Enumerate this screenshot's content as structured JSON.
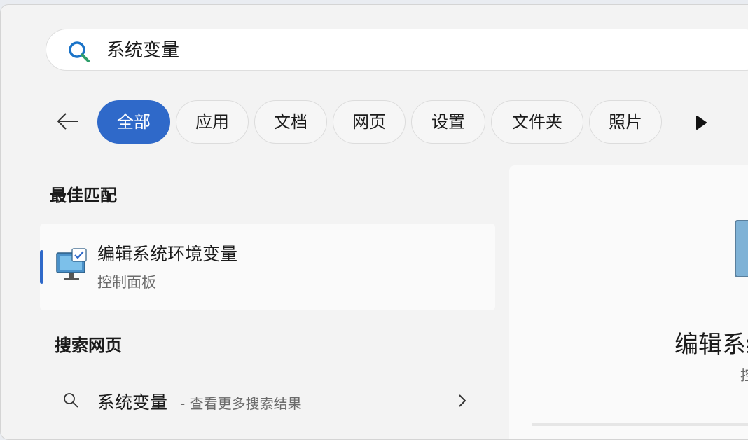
{
  "search": {
    "query": "系统变量"
  },
  "filters": [
    {
      "label": "全部",
      "active": true
    },
    {
      "label": "应用",
      "active": false
    },
    {
      "label": "文档",
      "active": false
    },
    {
      "label": "网页",
      "active": false
    },
    {
      "label": "设置",
      "active": false
    },
    {
      "label": "文件夹",
      "active": false
    },
    {
      "label": "照片",
      "active": false
    }
  ],
  "best_match": {
    "section_title": "最佳匹配",
    "item": {
      "title": "编辑系统环境变量",
      "subtitle": "控制面板",
      "icon": "computer-settings-icon"
    }
  },
  "web_search": {
    "section_title": "搜索网页",
    "item": {
      "query": "系统变量",
      "suffix": "- 查看更多搜索结果"
    }
  },
  "preview": {
    "title": "编辑系统环境变量",
    "subtitle": "控制面板"
  },
  "colors": {
    "accent": "#2f69c9",
    "search_icon": "#1a73c8",
    "search_icon_accent": "#2e9e6a"
  }
}
